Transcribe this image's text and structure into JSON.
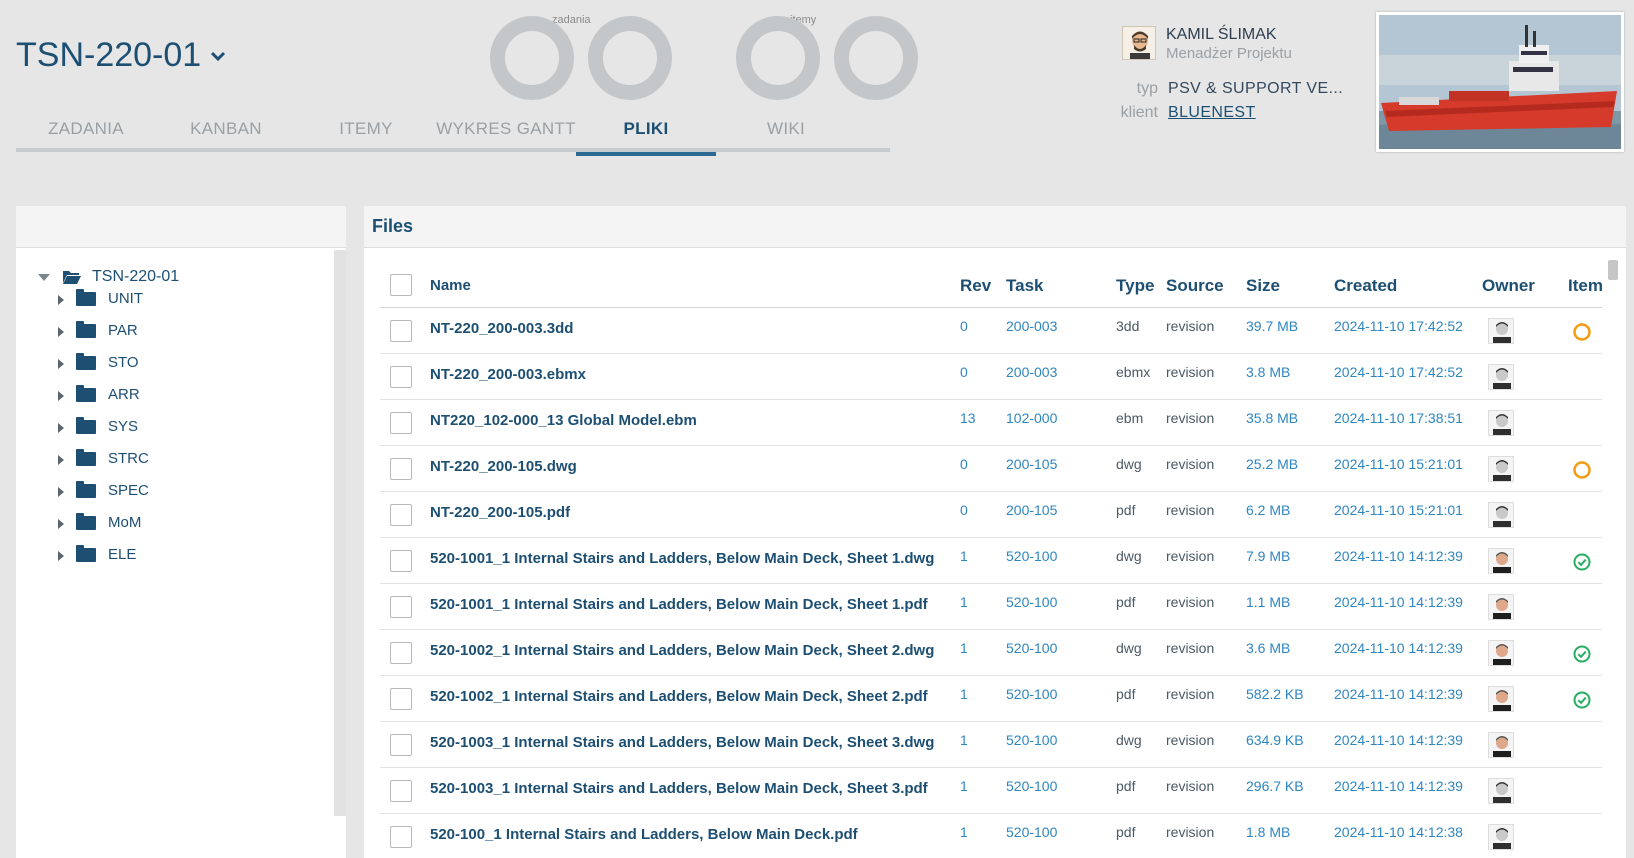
{
  "project": {
    "title": "TSN-220-01"
  },
  "rings": {
    "label_left": "zadania",
    "label_right": "itemy"
  },
  "tabs": [
    {
      "label": "ZADANIA",
      "active": false
    },
    {
      "label": "KANBAN",
      "active": false
    },
    {
      "label": "ITEMY",
      "active": false
    },
    {
      "label": "WYKRES GANTT",
      "active": false
    },
    {
      "label": "PLIKI",
      "active": true
    },
    {
      "label": "WIKI",
      "active": false
    }
  ],
  "manager": {
    "name": "KAMIL ŚLIMAK",
    "role": "Menadżer Projektu"
  },
  "meta": {
    "type_key": "typ",
    "type_value": "PSV & SUPPORT VE...",
    "client_key": "klient",
    "client_value": "BLUENEST"
  },
  "tree": {
    "root": "TSN-220-01",
    "items": [
      "UNIT",
      "PAR",
      "STO",
      "ARR",
      "SYS",
      "STRC",
      "SPEC",
      "MoM",
      "ELE"
    ]
  },
  "files": {
    "title": "Files",
    "columns": {
      "name": "Name",
      "rev": "Rev",
      "task": "Task",
      "type": "Type",
      "source": "Source",
      "size": "Size",
      "created": "Created",
      "owner": "Owner",
      "item": "Item"
    },
    "rows": [
      {
        "name": "NT-220_200-003.3dd",
        "rev": "0",
        "task": "200-003",
        "type": "3dd",
        "source": "revision",
        "size": "39.7 MB",
        "created": "2024-11-10 17:42:52",
        "owner": "a",
        "item": "open-circle-icon"
      },
      {
        "name": "NT-220_200-003.ebmx",
        "rev": "0",
        "task": "200-003",
        "type": "ebmx",
        "source": "revision",
        "size": "3.8 MB",
        "created": "2024-11-10 17:42:52",
        "owner": "a",
        "item": ""
      },
      {
        "name": "NT220_102-000_13 Global Model.ebm",
        "rev": "13",
        "task": "102-000",
        "type": "ebm",
        "source": "revision",
        "size": "35.8 MB",
        "created": "2024-11-10 17:38:51",
        "owner": "a",
        "item": ""
      },
      {
        "name": "NT-220_200-105.dwg",
        "rev": "0",
        "task": "200-105",
        "type": "dwg",
        "source": "revision",
        "size": "25.2 MB",
        "created": "2024-11-10 15:21:01",
        "owner": "a",
        "item": "open-circle-icon"
      },
      {
        "name": "NT-220_200-105.pdf",
        "rev": "0",
        "task": "200-105",
        "type": "pdf",
        "source": "revision",
        "size": "6.2 MB",
        "created": "2024-11-10 15:21:01",
        "owner": "a",
        "item": ""
      },
      {
        "name": "520-1001_1 Internal Stairs and Ladders, Below Main Deck, Sheet 1.dwg",
        "rev": "1",
        "task": "520-100",
        "type": "dwg",
        "source": "revision",
        "size": "7.9 MB",
        "created": "2024-11-10 14:12:39",
        "owner": "b",
        "item": "check-circle-icon"
      },
      {
        "name": "520-1001_1 Internal Stairs and Ladders, Below Main Deck, Sheet 1.pdf",
        "rev": "1",
        "task": "520-100",
        "type": "pdf",
        "source": "revision",
        "size": "1.1 MB",
        "created": "2024-11-10 14:12:39",
        "owner": "b",
        "item": ""
      },
      {
        "name": "520-1002_1 Internal Stairs and Ladders, Below Main Deck, Sheet 2.dwg",
        "rev": "1",
        "task": "520-100",
        "type": "dwg",
        "source": "revision",
        "size": "3.6 MB",
        "created": "2024-11-10 14:12:39",
        "owner": "b",
        "item": "check-circle-icon"
      },
      {
        "name": "520-1002_1 Internal Stairs and Ladders, Below Main Deck, Sheet 2.pdf",
        "rev": "1",
        "task": "520-100",
        "type": "pdf",
        "source": "revision",
        "size": "582.2 KB",
        "created": "2024-11-10 14:12:39",
        "owner": "b",
        "item": "check-circle-icon"
      },
      {
        "name": "520-1003_1 Internal Stairs and Ladders, Below Main Deck, Sheet 3.dwg",
        "rev": "1",
        "task": "520-100",
        "type": "dwg",
        "source": "revision",
        "size": "634.9 KB",
        "created": "2024-11-10 14:12:39",
        "owner": "b",
        "item": ""
      },
      {
        "name": "520-1003_1 Internal Stairs and Ladders, Below Main Deck, Sheet 3.pdf",
        "rev": "1",
        "task": "520-100",
        "type": "pdf",
        "source": "revision",
        "size": "296.7 KB",
        "created": "2024-11-10 14:12:39",
        "owner": "a",
        "item": ""
      },
      {
        "name": "520-100_1 Internal Stairs and Ladders, Below Main Deck.pdf",
        "rev": "1",
        "task": "520-100",
        "type": "pdf",
        "source": "revision",
        "size": "1.8 MB",
        "created": "2024-11-10 14:12:38",
        "owner": "a",
        "item": ""
      }
    ]
  },
  "colors": {
    "accent": "#1d4f73",
    "link": "#2e86c1",
    "open": "#f39c12",
    "done": "#27ae60"
  }
}
